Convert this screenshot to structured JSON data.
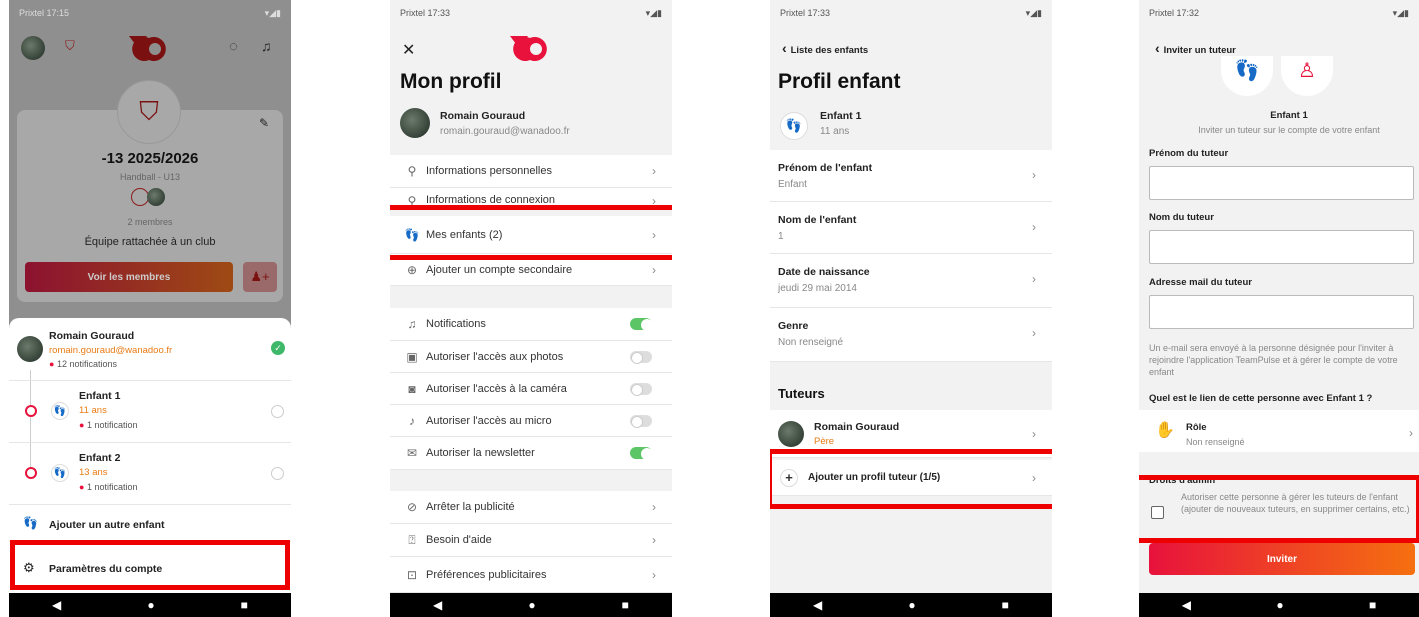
{
  "s1": {
    "time": "Prixtel 17:15",
    "team": "-13 2025/2026",
    "category": "Handball - U13",
    "members_count": "2 membres",
    "club_status": "Équipe rattachée à un club",
    "see_members": "Voir les membres",
    "account": {
      "name": "Romain Gouraud",
      "email": "romain.gouraud@wanadoo.fr",
      "notif": "12 notifications"
    },
    "child1": {
      "name": "Enfant 1",
      "age": "11 ans",
      "notif": "1 notification"
    },
    "child2": {
      "name": "Enfant 2",
      "age": "13 ans",
      "notif": "1 notification"
    },
    "add_child": "Ajouter un autre enfant",
    "settings": "Paramètres du compte"
  },
  "s2": {
    "time": "Prixtel 17:33",
    "title": "Mon profil",
    "name": "Romain Gouraud",
    "email": "romain.gouraud@wanadoo.fr",
    "items": [
      "Informations personnelles",
      "Informations de connexion",
      "Mes enfants (2)",
      "Ajouter un compte secondaire"
    ],
    "toggles": [
      {
        "label": "Notifications",
        "on": true
      },
      {
        "label": "Autoriser l'accès aux photos",
        "on": false
      },
      {
        "label": "Autoriser l'accès à la caméra",
        "on": false
      },
      {
        "label": "Autoriser l'accès au micro",
        "on": false
      },
      {
        "label": "Autoriser la newsletter",
        "on": true
      }
    ],
    "more": [
      "Arrêter la publicité",
      "Besoin d'aide",
      "Préférences publicitaires"
    ]
  },
  "s3": {
    "time": "Prixtel 17:33",
    "back": "Liste des enfants",
    "title": "Profil enfant",
    "child_name": "Enfant 1",
    "child_age": "11 ans",
    "fields": [
      {
        "label": "Prénom de l'enfant",
        "value": "Enfant"
      },
      {
        "label": "Nom de l'enfant",
        "value": "1"
      },
      {
        "label": "Date de naissance",
        "value": "jeudi 29 mai 2014"
      },
      {
        "label": "Genre",
        "value": "Non renseigné"
      }
    ],
    "tutors_title": "Tuteurs",
    "tutor_name": "Romain Gouraud",
    "tutor_role": "Père",
    "add_tutor": "Ajouter un profil tuteur (1/5)"
  },
  "s4": {
    "time": "Prixtel 17:32",
    "back": "Inviter un tuteur",
    "child_name": "Enfant 1",
    "invite_text": "Inviter un tuteur sur le compte de votre enfant",
    "first_label": "Prénom du tuteur",
    "last_label": "Nom du tuteur",
    "mail_label": "Adresse mail du tuteur",
    "info": "Un e-mail sera envoyé à la personne désignée pour l'inviter à rejoindre l'application TeamPulse et à gérer le compte de votre enfant",
    "link_q": "Quel est le lien de cette personne avec Enfant 1 ?",
    "role": "Rôle",
    "role_val": "Non renseigné",
    "admin_title": "Droits d'admin",
    "admin_text": "Autoriser cette personne à gérer les tuteurs de l'enfant (ajouter de nouveaux tuteurs, en supprimer certains, etc.)",
    "invite_btn": "Inviter"
  },
  "colors": {
    "highlight": "#ee0000",
    "brand": "#e8123c",
    "accent_orange": "#e87b15",
    "toggle_on": "#5cc566"
  }
}
